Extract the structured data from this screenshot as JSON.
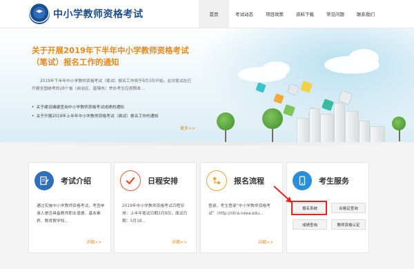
{
  "header": {
    "site_title": "中小学教师资格考试",
    "nav": [
      "首页",
      "考试动态",
      "项目政策",
      "资料下载",
      "常见问题",
      "联系我们"
    ]
  },
  "banner": {
    "headline": "关于开展2019年下半年中小学教师资格考试（笔试）报名工作的通知",
    "summary": "2019年下半年中小学教师资格考试（笔试）报名工作将于9月3日开始，此次笔试在已开展全国统考的28个省（自治区、直辖市）举办考生应按照本...",
    "news": [
      "关于建设编缓查询中小学教师资格考试成绩的通知",
      "关于开展2019年上半年中小学教师资格考试（面试）报名工作的通知"
    ],
    "more": "更多>>"
  },
  "cards": [
    {
      "title": "考试介绍",
      "icon": "document-pen-icon",
      "text": "通过实施中小学教师资格考试，考查申请人是否具备教师职业道德、基本素养、教育教学知...",
      "more": "详细>>",
      "color": "#2f6fb7"
    },
    {
      "title": "日程安排",
      "icon": "checkmark-icon",
      "text": "2019年中小学教师资格考试日程安排：上半年笔试日期3月9日，面试日期：5月18...",
      "more": "详细>>",
      "color": "#e2582a"
    },
    {
      "title": "报名流程",
      "icon": "flow-steps-icon",
      "text": "登录。考生登录“中小学教师资格考试”（http://ntce.neea.edu...",
      "more": "详细>>",
      "color": "#f0a02a"
    },
    {
      "title": "考生服务",
      "icon": "phone-service-icon",
      "color": "#2a8fd6"
    }
  ],
  "services": {
    "buttons": [
      "报名系统",
      "合格证查询",
      "成绩查询",
      "教师资格认定"
    ]
  },
  "colors": {
    "accent": "#e5891b",
    "brand": "#1e4e87",
    "highlight": "#e2261d"
  }
}
